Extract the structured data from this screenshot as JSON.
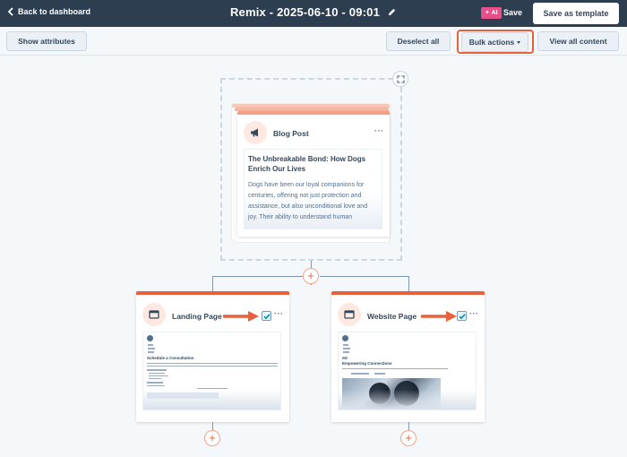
{
  "topbar": {
    "back_label": "Back to dashboard",
    "title": "Remix - 2025-06-10 - 09:01",
    "ai_badge": "✦ AI",
    "save_label": "Save",
    "save_template_label": "Save as template"
  },
  "toolbar": {
    "show_attributes_label": "Show attributes",
    "deselect_all_label": "Deselect all",
    "bulk_actions_label": "Bulk actions",
    "view_all_content_label": "View all content"
  },
  "source_card": {
    "type_label": "Blog Post",
    "more_label": "···",
    "post_title": "The Unbreakable Bond: How Dogs Enrich Our Lives",
    "post_excerpt": "Dogs have been our loyal companions for centuries, offering not just protection and assistance, but also unconditional love and joy. Their ability to understand human"
  },
  "output_cards": [
    {
      "type_label": "Landing Page",
      "more_label": "···",
      "selected": true,
      "preview_heading": "Schedule a Consultation"
    },
    {
      "type_label": "Website Page",
      "more_label": "···",
      "selected": true,
      "preview_heading": "Empowering Connections"
    }
  ],
  "icons": {
    "back": "chevron-left-icon",
    "edit": "pencil-icon",
    "expand": "expand-icon",
    "blog": "megaphone-icon",
    "page": "browser-window-icon",
    "check": "checkmark-icon",
    "add": "plus-icon"
  },
  "colors": {
    "topbar_bg": "#2d3e50",
    "accent": "#e8613c",
    "ai_badge": "#e84e89",
    "check": "#0091ae"
  }
}
